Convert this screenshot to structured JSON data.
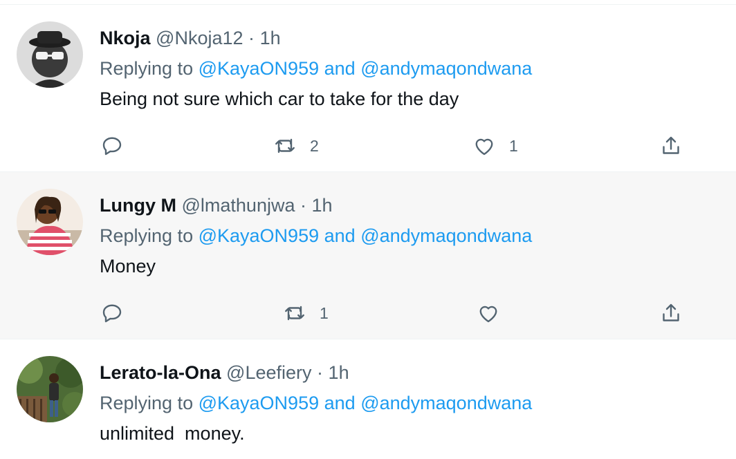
{
  "tweets": [
    {
      "name": "Nkoja",
      "handle": "@Nkoja12",
      "separator": "·",
      "time": "1h",
      "replying_prefix": "Replying to",
      "mention_1": "@KayaON959",
      "conjunction": "and",
      "mention_2": "@andymaqondwana",
      "text": "Being not sure which car to take for the day",
      "retweets": "2",
      "likes": "1"
    },
    {
      "name": "Lungy M",
      "handle": "@lmathunjwa",
      "separator": "·",
      "time": "1h",
      "replying_prefix": "Replying to",
      "mention_1": "@KayaON959",
      "conjunction": "and",
      "mention_2": "@andymaqondwana",
      "text": "Money",
      "retweets": "1",
      "likes": ""
    },
    {
      "name": "Lerato-la-Ona",
      "handle": "@Leefiery",
      "separator": "·",
      "time": "1h",
      "replying_prefix": "Replying to",
      "mention_1": "@KayaON959",
      "conjunction": "and",
      "mention_2": "@andymaqondwana",
      "text": "unlimited  money."
    }
  ],
  "icons": {
    "reply": "reply-bubble-icon",
    "retweet": "retweet-icon",
    "like": "heart-icon",
    "share": "share-upload-icon"
  },
  "colors": {
    "accent": "#1d9bf0",
    "secondary_text": "#536471",
    "hover_background": "#f7f7f7"
  }
}
